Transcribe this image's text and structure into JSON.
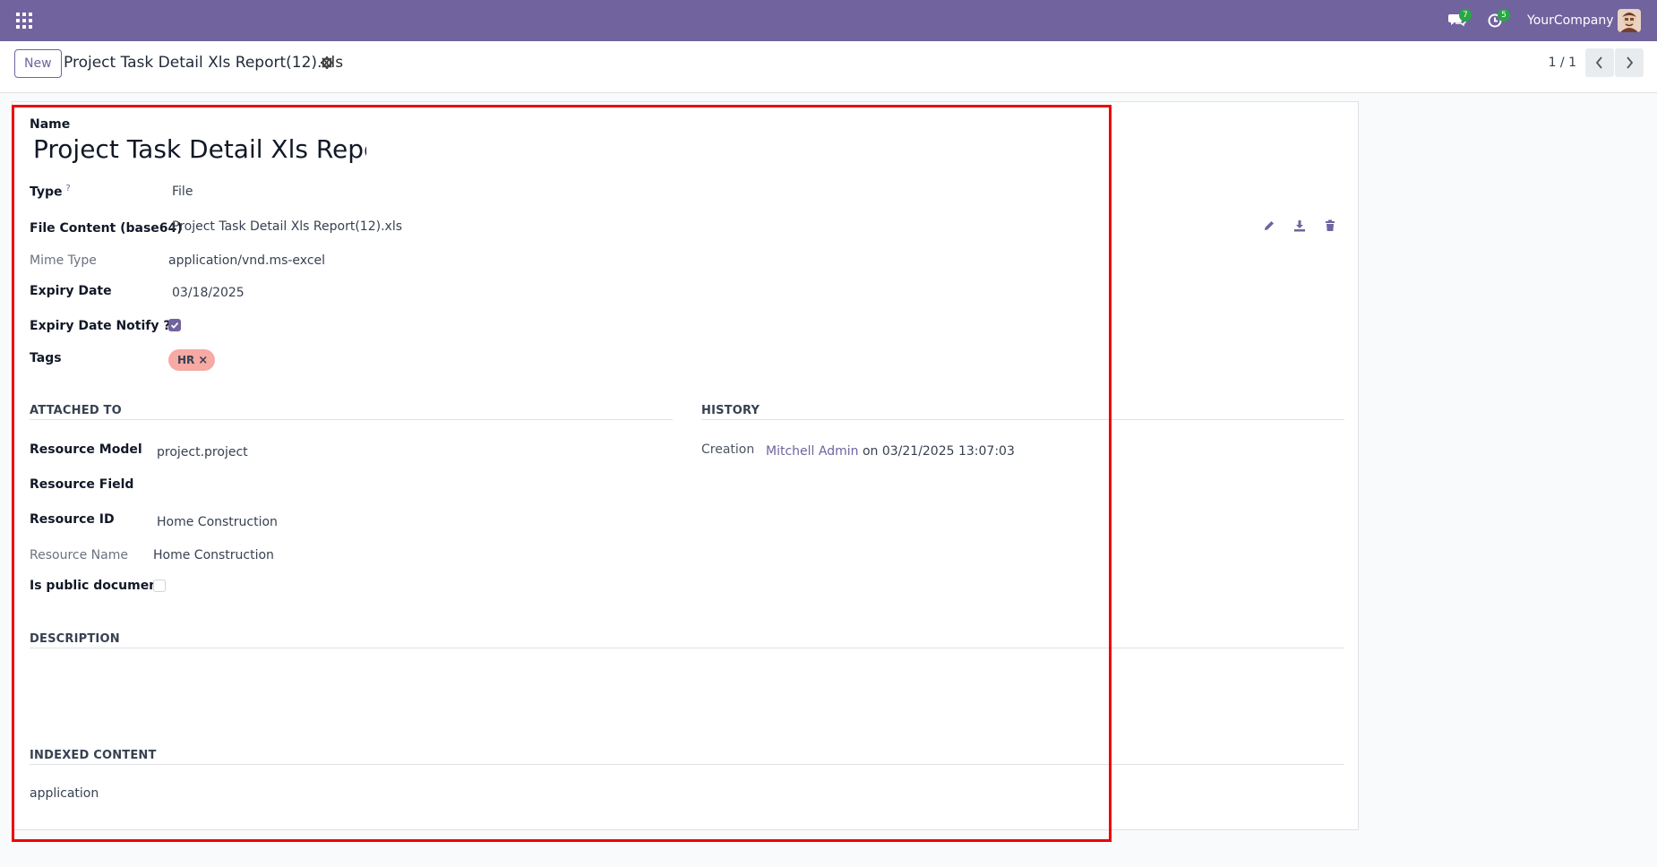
{
  "navbar": {
    "apps_icon": "apps-grid-icon",
    "messages_icon": "chat-icon",
    "messages_count": "7",
    "activities_icon": "clock-icon",
    "activities_count": "5",
    "company": "YourCompany",
    "avatar_icon": "user-avatar",
    "color": "#71639e"
  },
  "control": {
    "new_label": "New",
    "breadcrumb_title": "Project Task Detail Xls Report(12).xls",
    "gear_icon": "gear-icon",
    "pager": "1 / 1"
  },
  "form": {
    "name_label": "Name",
    "name_value": "Project Task Detail Xls Report",
    "type_label": "Type",
    "type_help": "?",
    "type_value": "File",
    "file_content_label": "File Content (base64)",
    "file_content_value": "Project Task Detail Xls Report(12).xls",
    "mime_label": "Mime Type",
    "mime_value": "application/vnd.ms-excel",
    "expiry_label": "Expiry Date",
    "expiry_value": "03/18/2025",
    "notify_label": "Expiry Date Notify ??",
    "notify_checked": true,
    "tags_label": "Tags",
    "tags": [
      {
        "label": "HR",
        "remove": "×",
        "color": "#f7a9a4"
      }
    ]
  },
  "attached_to": {
    "title": "ATTACHED TO",
    "resource_model_label": "Resource Model",
    "resource_model_value": "project.project",
    "resource_field_label": "Resource Field",
    "resource_id_label": "Resource ID",
    "resource_id_value": "Home Construction",
    "resource_name_label": "Resource Name",
    "resource_name_value": "Home Construction",
    "public_label": "Is public document",
    "public_checked": false
  },
  "history": {
    "title": "HISTORY",
    "creation_label": "Creation",
    "creation_user": "Mitchell Admin",
    "creation_rest": "on 03/21/2025 13:07:03"
  },
  "description": {
    "title": "DESCRIPTION"
  },
  "indexed": {
    "title": "INDEXED CONTENT",
    "value": "application"
  },
  "highlight_color": "#ee0000"
}
